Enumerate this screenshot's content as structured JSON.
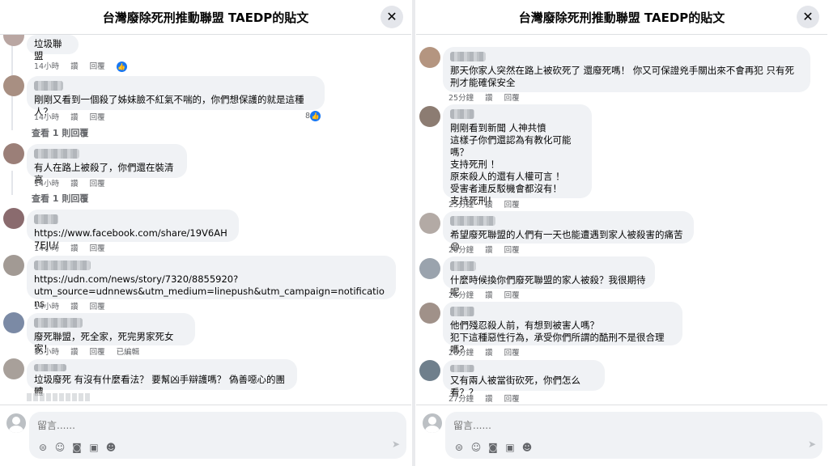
{
  "left_panel": {
    "title": "台灣廢除死刑推動聯盟 TAEDP的貼文",
    "comments": [
      {
        "text": "垃圾聯盟",
        "time": "14小時",
        "reply": "回覆",
        "like": "讚"
      },
      {
        "text": "剛剛又看到一個殺了姊妹臉不紅氣不喘的，你們想保護的就是這種人？",
        "time": "14小時",
        "reply": "回覆",
        "like": "讚",
        "reactions": "8",
        "view_replies": "查看 1 則回覆"
      },
      {
        "text": "有人在路上被殺了，你們還在裝清高",
        "time": "14小時",
        "reply": "回覆",
        "like": "讚",
        "view_replies": "查看 1 則回覆"
      },
      {
        "text": "https://www.facebook.com/share/19V6AH7EJU/",
        "time": "14小時",
        "reply": "回覆",
        "like": "讚"
      },
      {
        "text": "https://udn.com/news/story/7320/8855920?\nutm_source=udnnews&utm_medium=linepush&utm_campaign=notifications",
        "time": "14小時",
        "reply": "回覆",
        "like": "讚"
      },
      {
        "text": "廢死聯盟，死全家，死完男家死女家！",
        "time": "15小時",
        "reply": "回覆",
        "like": "讚",
        "edited": "已編輯"
      },
      {
        "text": "垃圾廢死 有沒有什麼看法？ 要幫凶手辯護嗎？ 偽善噁心的團體"
      }
    ],
    "input_placeholder": "留言......"
  },
  "right_panel": {
    "title": "台灣廢除死刑推動聯盟 TAEDP的貼文",
    "comments": [
      {
        "text": "那天你家人突然在路上被砍死了 還廢死嗎！ 你又可保證兇手關出來不會再犯 只有死刑才能確保安全",
        "time": "25分鐘",
        "reply": "回覆",
        "like": "讚"
      },
      {
        "text": "剛剛看到新聞 人神共憤\n這樣子你們還認為有教化可能嗎？\n支持死刑 ！\n原來殺人的還有人權可言 ！\n受害者連反駁機會都沒有！\n支持死刑！",
        "time": "25分鐘",
        "reply": "回覆",
        "like": "讚"
      },
      {
        "text": "希望廢死聯盟的人們有一天也能遭遇到家人被殺害的痛苦😄",
        "time": "26分鐘",
        "reply": "回覆",
        "like": "讚"
      },
      {
        "text": "什麼時候換你們廢死聯盟的家人被殺？我很期待呢",
        "time": "26分鐘",
        "reply": "回覆",
        "like": "讚"
      },
      {
        "text": "他們殘忍殺人前，有想到被害人嗎？\n犯下這種惡性行為，承受你們所謂的酷刑不是很合理嗎？",
        "time": "26分鐘",
        "reply": "回覆",
        "like": "讚"
      },
      {
        "text": "又有兩人被當街砍死，你們怎么看？？",
        "time": "27分鐘",
        "reply": "回覆",
        "like": "讚"
      }
    ],
    "input_placeholder": "留言......"
  },
  "close_glyph": "✕",
  "icons": [
    "sticker-icon",
    "emoji-icon",
    "camera-icon",
    "gif-icon",
    "avatar-sticker-icon",
    "send-icon"
  ],
  "colors": {
    "bubble": "#f0f2f5",
    "like_blue": "#1877f2",
    "meta_gray": "#65676b"
  }
}
